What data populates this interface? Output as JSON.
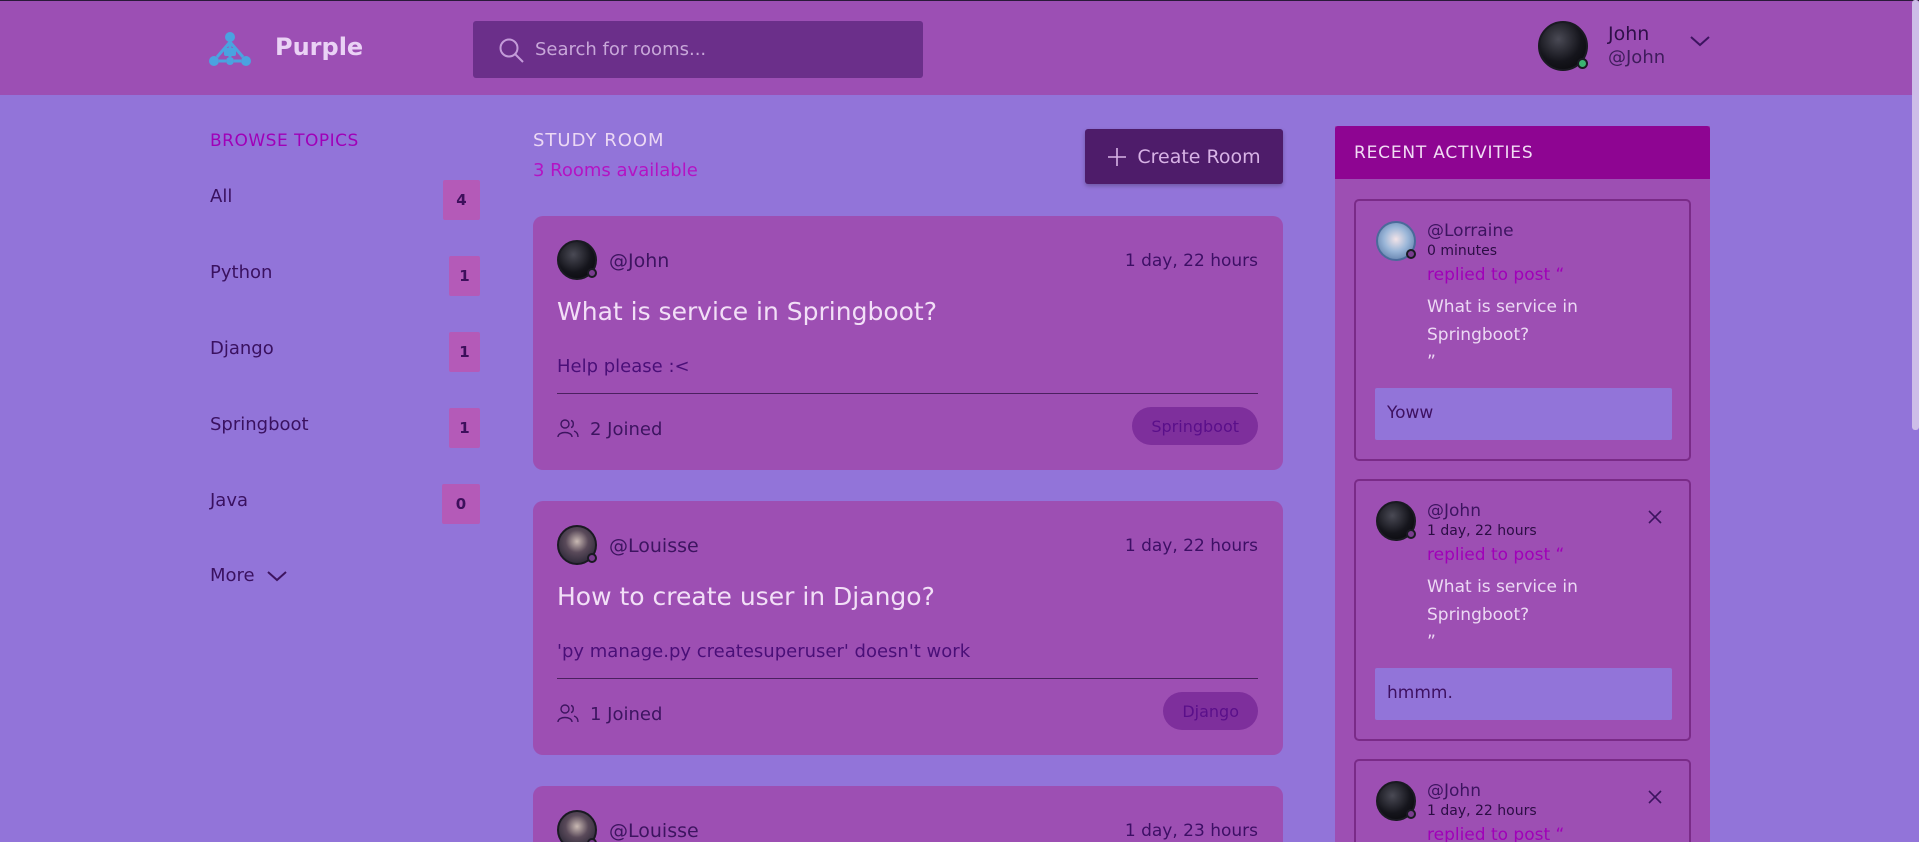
{
  "header": {
    "brand": "Purple",
    "search_placeholder": "Search for rooms...",
    "user": {
      "name": "John",
      "handle": "@John"
    }
  },
  "sidebar": {
    "title": "BROWSE TOPICS",
    "topics": [
      {
        "label": "All",
        "count": "4"
      },
      {
        "label": "Python",
        "count": "1"
      },
      {
        "label": "Django",
        "count": "1"
      },
      {
        "label": "Springboot",
        "count": "1"
      },
      {
        "label": "Java",
        "count": "0"
      }
    ],
    "more_label": "More"
  },
  "main": {
    "title": "STUDY ROOM",
    "subtitle": "3 Rooms available",
    "create_label": "Create Room",
    "rooms": [
      {
        "host": "@John",
        "time": "1 day, 22 hours",
        "title": "What is service in Springboot?",
        "description": "Help please :<",
        "joined": "2 Joined",
        "topic": "Springboot"
      },
      {
        "host": "@Louisse",
        "time": "1 day, 22 hours",
        "title": "How to create user in Django?",
        "description": "'py manage.py createsuperuser' doesn't work",
        "joined": "1 Joined",
        "topic": "Django"
      },
      {
        "host": "@Louisse",
        "time": "1 day, 23 hours"
      }
    ]
  },
  "activity": {
    "title": "RECENT ACTIVITIES",
    "items": [
      {
        "user": "@Lorraine",
        "time": "0 minutes",
        "action": "replied to post “",
        "post": "What is service in Springboot?",
        "close_quote": "”",
        "reply": "Yoww"
      },
      {
        "user": "@John",
        "time": "1 day, 22 hours",
        "action": "replied to post “",
        "post": "What is service in Springboot?",
        "close_quote": "”",
        "reply": "hmmm."
      },
      {
        "user": "@John",
        "time": "1 day, 22 hours",
        "action": "replied to post “"
      }
    ]
  },
  "colors": {
    "background": "#9274d9",
    "header": "#9c4fb4",
    "card": "#9d4fb3",
    "accent": "#a000b8",
    "activity_header": "#8e0592",
    "online": "#3cb371"
  }
}
